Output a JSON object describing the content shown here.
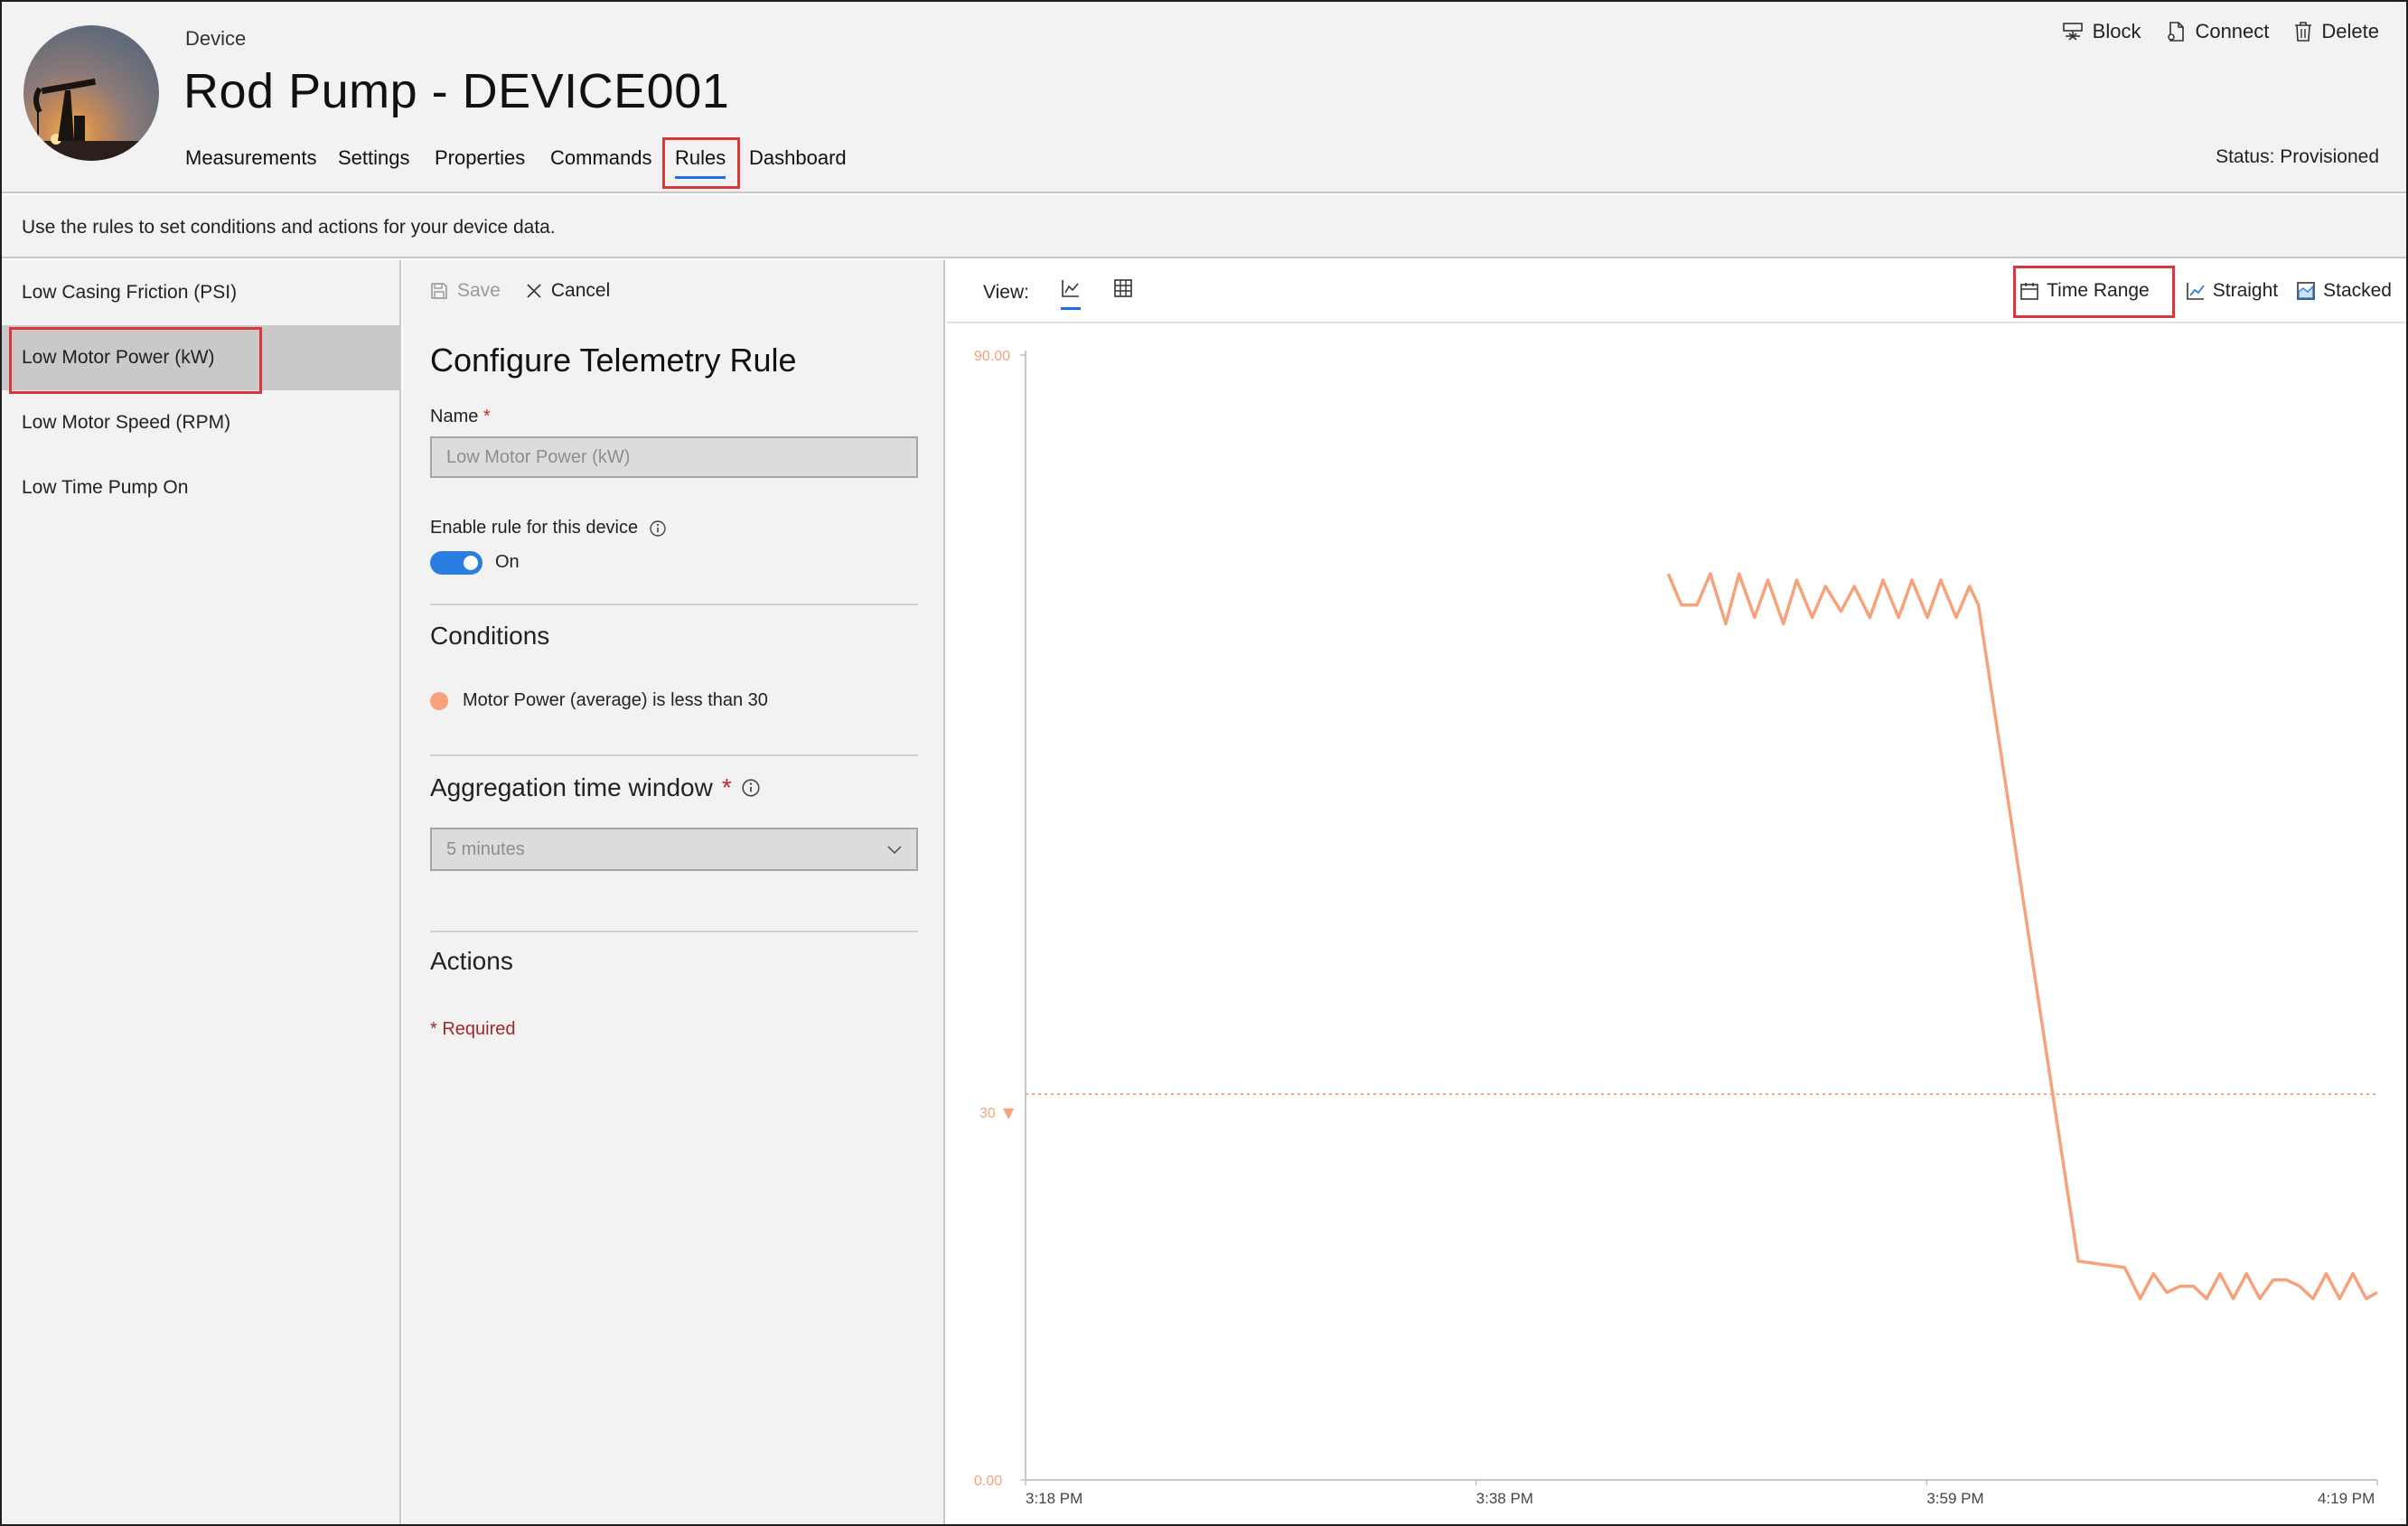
{
  "header": {
    "crumb": "Device",
    "title": "Rod Pump - DEVICE001",
    "status": "Status: Provisioned",
    "tabs": [
      {
        "label": "Measurements"
      },
      {
        "label": "Settings"
      },
      {
        "label": "Properties"
      },
      {
        "label": "Commands"
      },
      {
        "label": "Rules"
      },
      {
        "label": "Dashboard"
      }
    ],
    "actions": {
      "block": "Block",
      "connect": "Connect",
      "delete": "Delete"
    }
  },
  "description": "Use the rules to set conditions and actions for your device data.",
  "rules": [
    {
      "label": "Low Casing Friction (PSI)"
    },
    {
      "label": "Low Motor Power (kW)"
    },
    {
      "label": "Low Motor Speed (RPM)"
    },
    {
      "label": "Low Time Pump On"
    }
  ],
  "config": {
    "save": "Save",
    "cancel": "Cancel",
    "title": "Configure Telemetry Rule",
    "name_label": "Name",
    "name_placeholder": "Low Motor Power (kW)",
    "enable_label": "Enable rule for this device",
    "toggle_state": "On",
    "conditions_heading": "Conditions",
    "condition_text": "Motor Power (average) is less than 30",
    "aggregation_label": "Aggregation time window",
    "aggregation_value": "5 minutes",
    "actions_heading": "Actions",
    "required_note": "* Required",
    "required_star": "*"
  },
  "chart_toolbar": {
    "view_label": "View:",
    "time_range": "Time Range",
    "straight": "Straight",
    "stacked": "Stacked"
  },
  "colors": {
    "series": "#f6a27b",
    "accent": "#1f6fe0",
    "highlight": "#d9363e"
  },
  "chart_data": {
    "type": "line",
    "xlabel": "",
    "ylabel": "",
    "ylim": [
      0,
      90
    ],
    "y_ticks": [
      "90.00",
      "30",
      "0.00"
    ],
    "x_ticks": [
      "3:18 PM",
      "3:38 PM",
      "3:59 PM",
      "4:19 PM"
    ],
    "x_range_minutes": [
      0,
      61
    ],
    "threshold": {
      "value": 30,
      "style": "dotted"
    },
    "series": [
      {
        "x": [
          29,
          29.6,
          30.3,
          30.9,
          31.6,
          32.2,
          32.9,
          33.5,
          34.2,
          34.8,
          35.5,
          36.1,
          36.8,
          37.4,
          38.1,
          38.7,
          39.4,
          40,
          40.7,
          41.3,
          42,
          42.6,
          43,
          47.5,
          49.6,
          50.3,
          50.9,
          51.5,
          52.1,
          52.7,
          53.3,
          53.9,
          54.5,
          55.1,
          55.7,
          56.3,
          56.9,
          57.5,
          58.1,
          58.7,
          59.3,
          59.9,
          60.5,
          61
        ],
        "y": [
          72.5,
          70,
          70,
          72.5,
          68.5,
          72.5,
          69,
          72,
          68.5,
          72,
          69,
          71.5,
          69.5,
          71.5,
          69,
          72,
          69,
          72,
          69,
          72,
          69,
          71.5,
          70,
          17.5,
          17,
          14.5,
          16.5,
          15,
          15.5,
          15.5,
          14.5,
          16.5,
          14.5,
          16.5,
          14.5,
          16,
          16,
          15.5,
          14.5,
          16.5,
          14.5,
          16.5,
          14.5,
          15
        ]
      }
    ]
  }
}
